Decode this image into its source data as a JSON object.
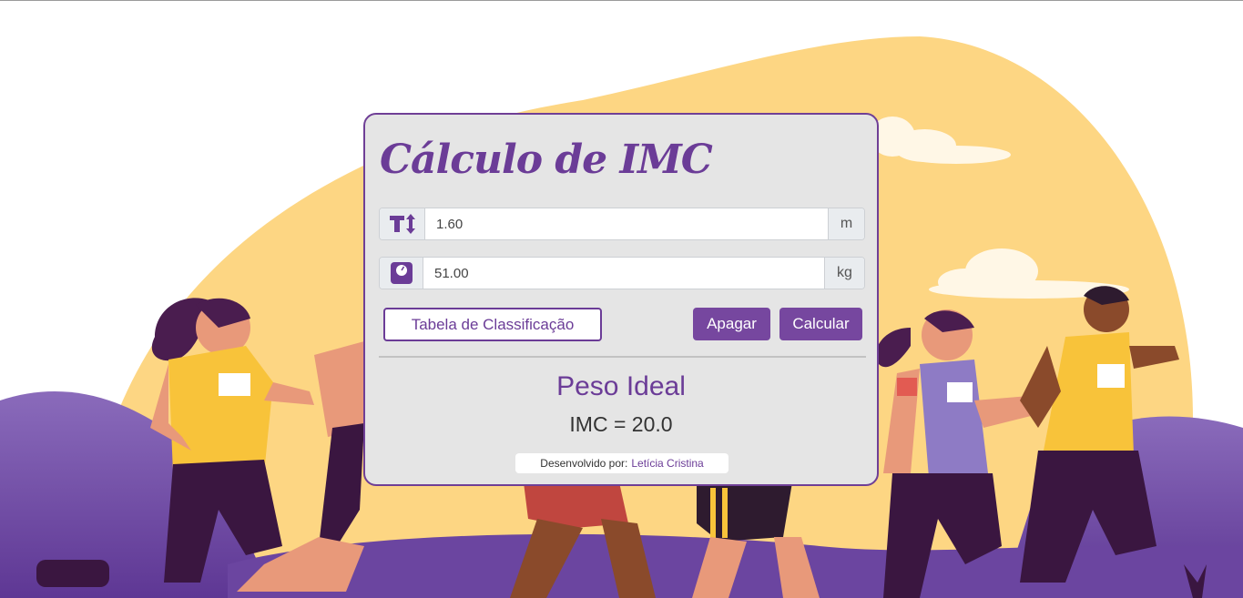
{
  "title": "Cálculo de IMC",
  "height_field": {
    "value": "1.60",
    "unit": "m",
    "icon": "text-height-icon"
  },
  "weight_field": {
    "value": "51.00",
    "unit": "kg",
    "icon": "weight-scale-icon"
  },
  "buttons": {
    "table": "Tabela de Classificação",
    "clear": "Apagar",
    "calculate": "Calcular"
  },
  "result": {
    "classification": "Peso Ideal",
    "imc": "IMC = 20.0"
  },
  "footer": {
    "prefix": "Desenvolvido por:",
    "author": "Letícia Cristina"
  },
  "colors": {
    "accent": "#6b3c97",
    "card_bg": "#e5e5e5",
    "sun": "#fdd683",
    "hills": "#7a57a8"
  }
}
